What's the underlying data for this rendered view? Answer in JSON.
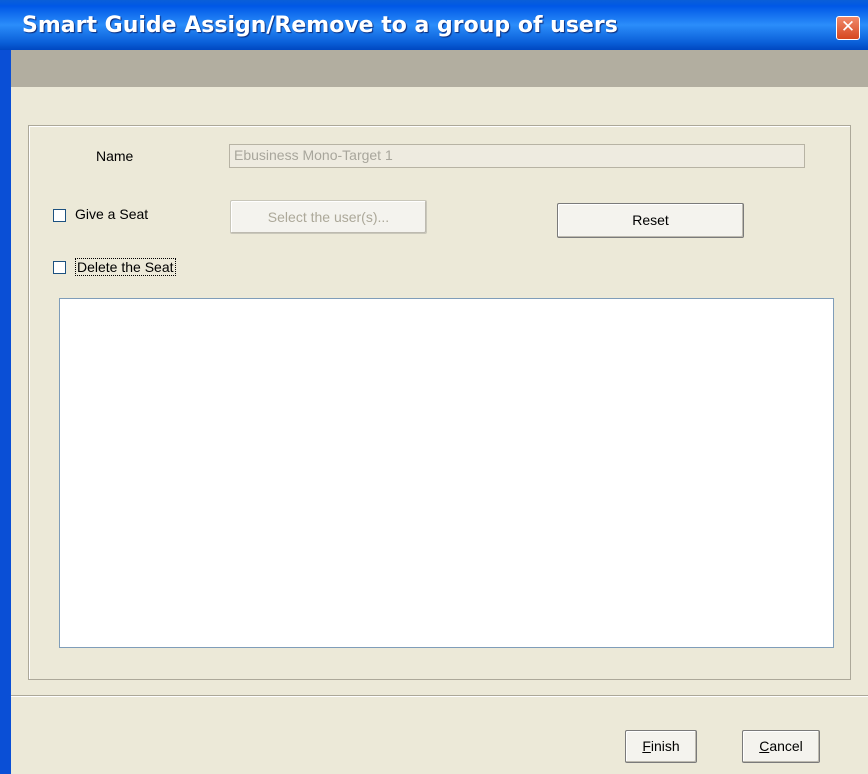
{
  "window": {
    "title": "Smart Guide Assign/Remove to a group of users",
    "close_glyph": "✕"
  },
  "form": {
    "name_label": "Name",
    "name_value": "Ebusiness Mono-Target 1",
    "give_seat_label": "Give a Seat",
    "give_seat_checked": false,
    "delete_seat_label": "Delete the Seat",
    "delete_seat_checked": false,
    "select_users_label": "Select the user(s)...",
    "reset_label": "Reset",
    "user_list": []
  },
  "footer": {
    "finish_mnemonic": "F",
    "finish_rest": "inish",
    "cancel_mnemonic": "C",
    "cancel_rest": "ancel"
  },
  "colors": {
    "titlebar": "#0058e6",
    "dialog_background": "#ece9d8",
    "band": "#b2aea0",
    "close_button": "#d6461f"
  }
}
